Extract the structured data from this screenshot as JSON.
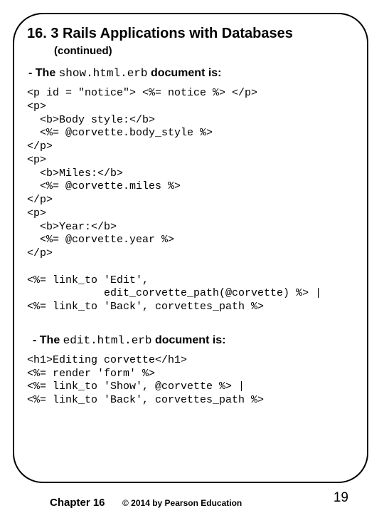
{
  "title": "16. 3 Rails Applications with Databases",
  "subtitle": "(continued)",
  "section1_prefix": " - The ",
  "section1_mono": "show.html.erb",
  "section1_suffix": " document is:",
  "code1": "<p id = \"notice\"> <%= notice %> </p>\n<p>\n  <b>Body style:</b>\n  <%= @corvette.body_style %>\n</p>\n<p>\n  <b>Miles:</b>\n  <%= @corvette.miles %>\n</p>\n<p>\n  <b>Year:</b>\n  <%= @corvette.year %>\n</p>\n\n<%= link_to 'Edit',\n            edit_corvette_path(@corvette) %> |\n<%= link_to 'Back', corvettes_path %>",
  "section2_prefix": " - The ",
  "section2_mono": "edit.html.erb",
  "section2_suffix": " document is:",
  "code2": "<h1>Editing corvette</h1>\n<%= render 'form' %>\n<%= link_to 'Show', @corvette %> |\n<%= link_to 'Back', corvettes_path %>",
  "footer": {
    "chapter": "Chapter 16",
    "copyright": "© 2014 by Pearson Education",
    "page": "19"
  }
}
